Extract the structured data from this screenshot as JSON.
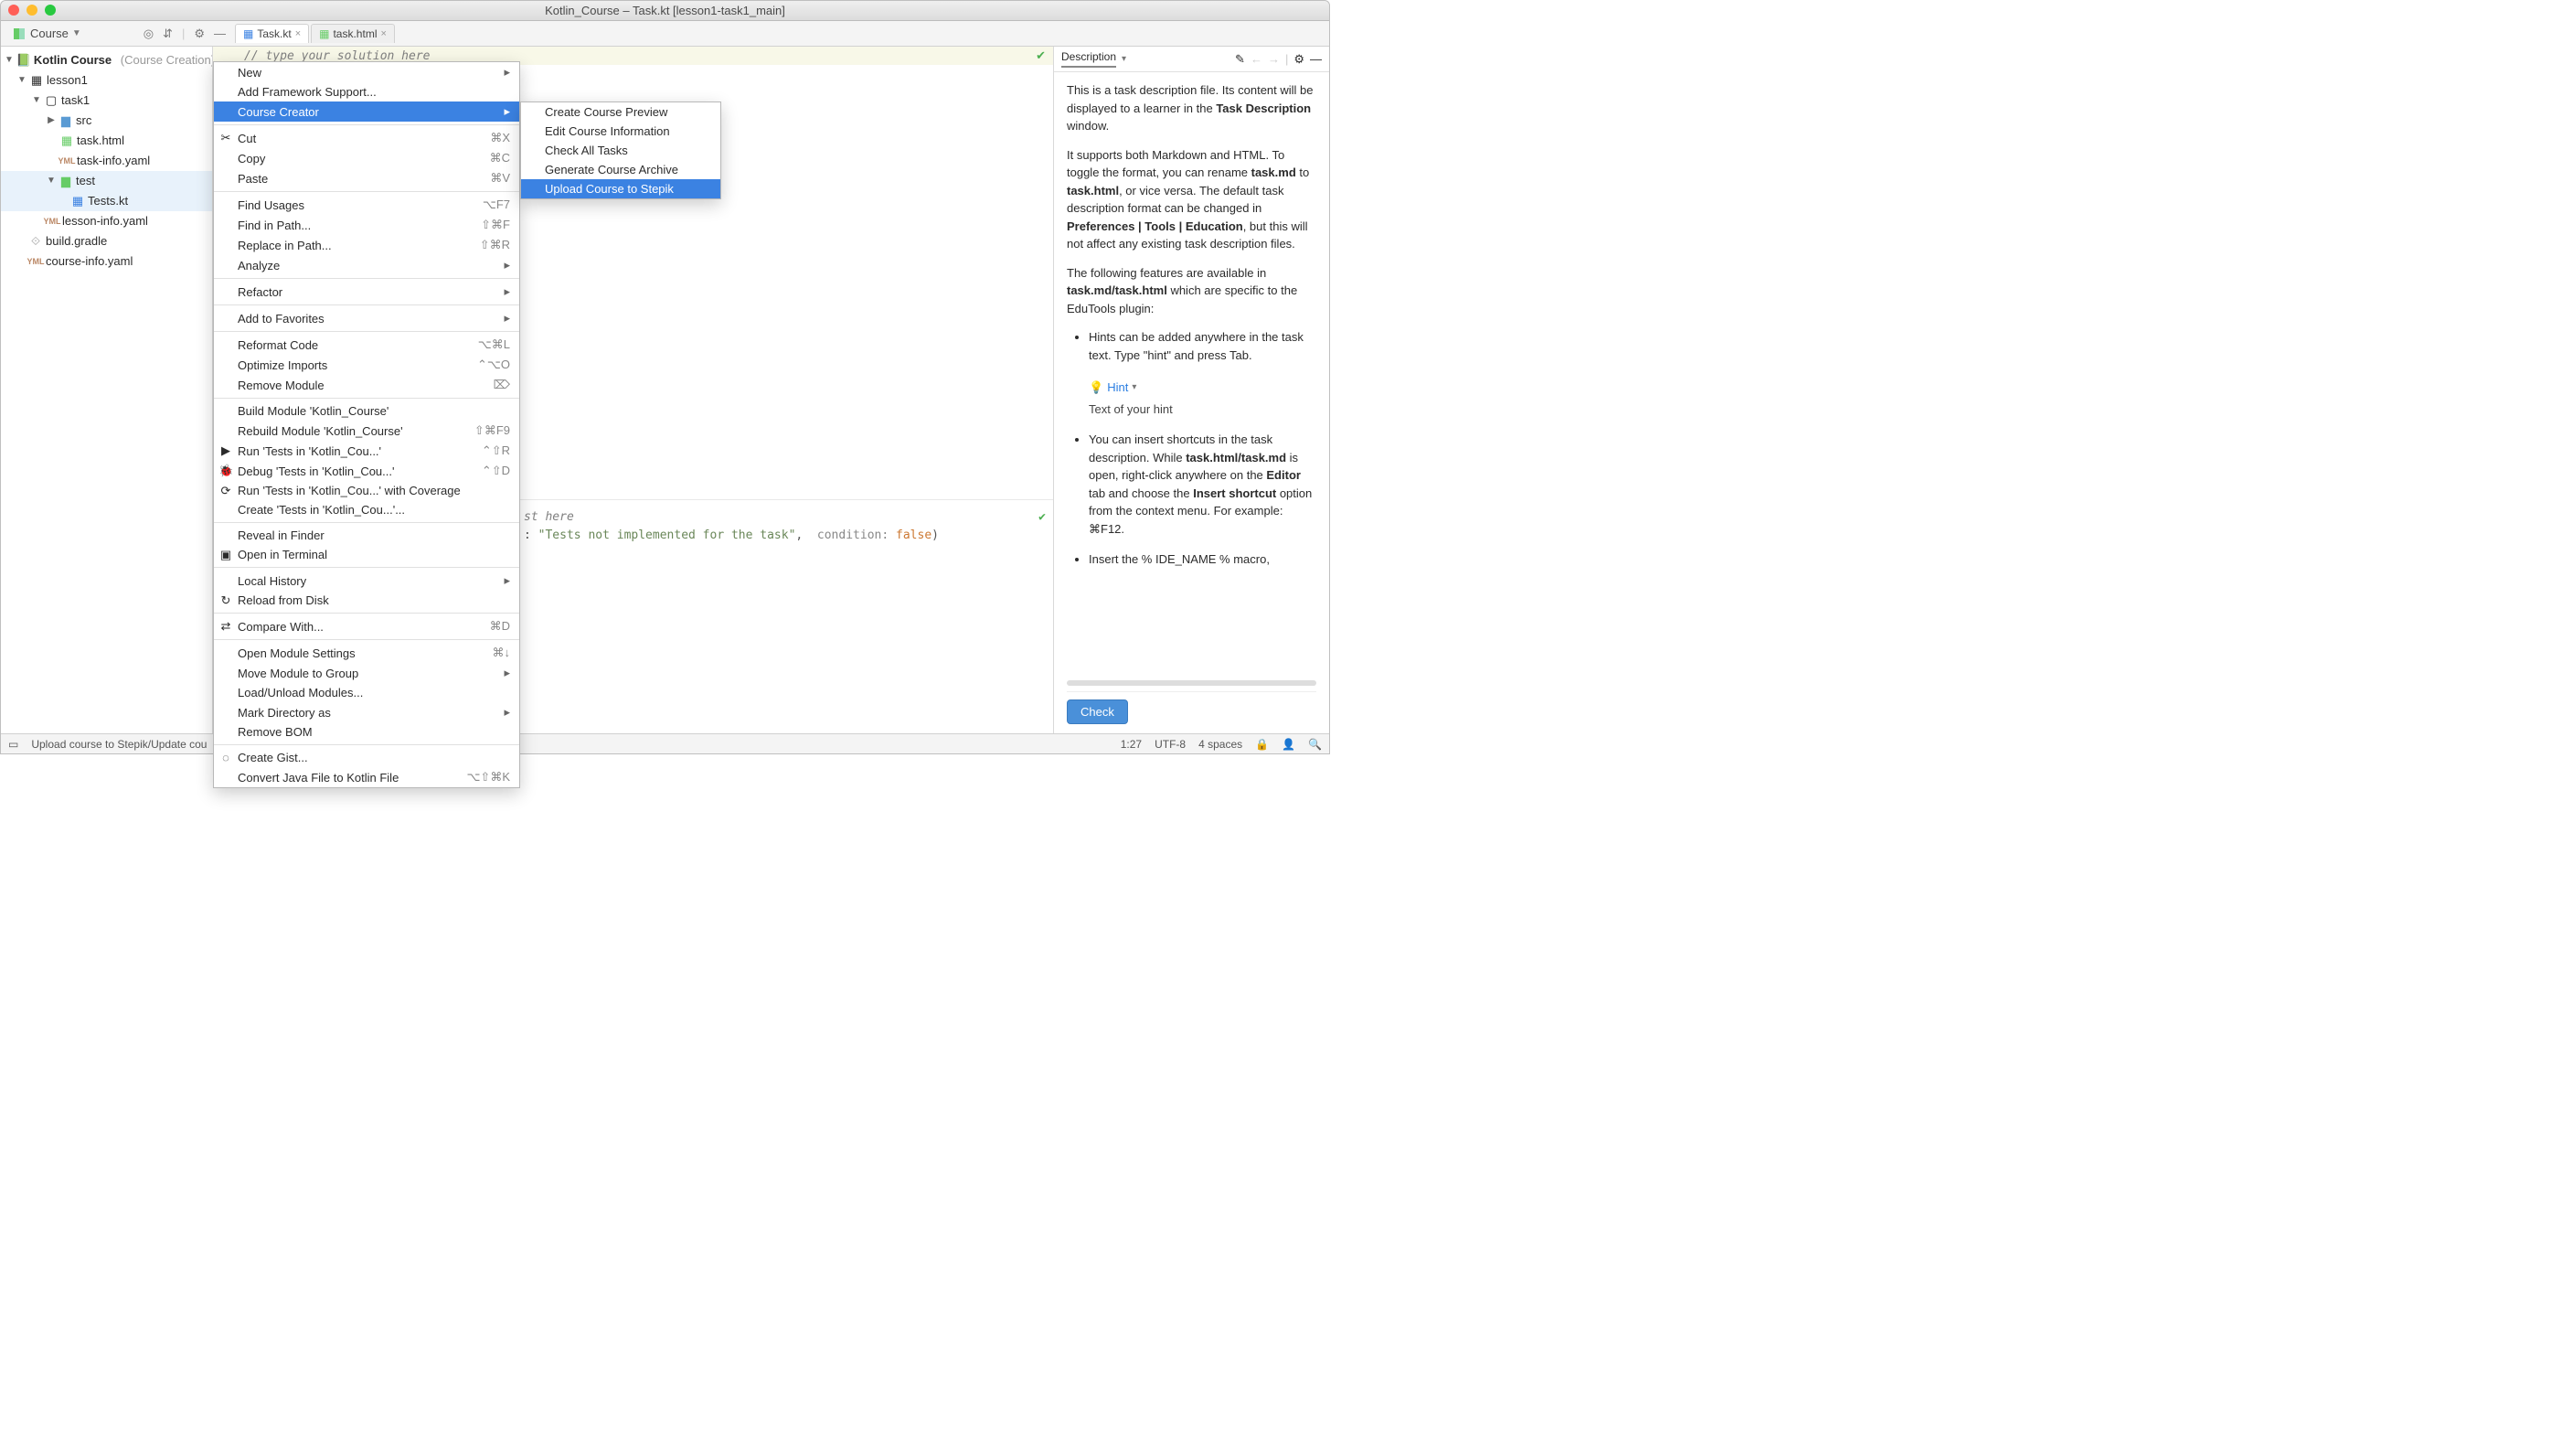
{
  "window": {
    "title": "Kotlin_Course – Task.kt [lesson1-task1_main]"
  },
  "toolbar": {
    "course_label": "Course"
  },
  "tabs": [
    {
      "label": "Task.kt",
      "active": true
    },
    {
      "label": "task.html",
      "active": false
    }
  ],
  "project_tree": {
    "root": "Kotlin Course",
    "root_suffix": "(Course Creation)",
    "items": {
      "lesson1": "lesson1",
      "task1": "task1",
      "src": "src",
      "task_html": "task.html",
      "task_info": "task-info.yaml",
      "test": "test",
      "tests_kt": "Tests.kt",
      "lesson_info": "lesson-info.yaml",
      "build_gradle": "build.gradle",
      "course_info": "course-info.yaml"
    }
  },
  "context_menu": [
    {
      "label": "New",
      "submenu": true
    },
    {
      "label": "Add Framework Support..."
    },
    {
      "label": "Course Creator",
      "submenu": true,
      "highlighted": true
    },
    {
      "sep": true
    },
    {
      "label": "Cut",
      "shortcut": "⌘X",
      "icon": "scissors"
    },
    {
      "label": "Copy",
      "shortcut": "⌘C"
    },
    {
      "label": "Paste",
      "shortcut": "⌘V"
    },
    {
      "sep": true
    },
    {
      "label": "Find Usages",
      "shortcut": "⌥F7"
    },
    {
      "label": "Find in Path...",
      "shortcut": "⇧⌘F"
    },
    {
      "label": "Replace in Path...",
      "shortcut": "⇧⌘R"
    },
    {
      "label": "Analyze",
      "submenu": true
    },
    {
      "sep": true
    },
    {
      "label": "Refactor",
      "submenu": true
    },
    {
      "sep": true
    },
    {
      "label": "Add to Favorites",
      "submenu": true
    },
    {
      "sep": true
    },
    {
      "label": "Reformat Code",
      "shortcut": "⌥⌘L"
    },
    {
      "label": "Optimize Imports",
      "shortcut": "⌃⌥O"
    },
    {
      "label": "Remove Module",
      "shortcut": "⌦"
    },
    {
      "sep": true
    },
    {
      "label": "Build Module 'Kotlin_Course'"
    },
    {
      "label": "Rebuild Module 'Kotlin_Course'",
      "shortcut": "⇧⌘F9"
    },
    {
      "label": "Run 'Tests in 'Kotlin_Cou...'",
      "shortcut": "⌃⇧R",
      "icon": "run"
    },
    {
      "label": "Debug 'Tests in 'Kotlin_Cou...'",
      "shortcut": "⌃⇧D",
      "icon": "debug"
    },
    {
      "label": "Run 'Tests in 'Kotlin_Cou...' with Coverage",
      "icon": "coverage"
    },
    {
      "label": "Create 'Tests in 'Kotlin_Cou...'..."
    },
    {
      "sep": true
    },
    {
      "label": "Reveal in Finder"
    },
    {
      "label": "Open in Terminal",
      "icon": "terminal"
    },
    {
      "sep": true
    },
    {
      "label": "Local History",
      "submenu": true
    },
    {
      "label": "Reload from Disk",
      "icon": "reload"
    },
    {
      "sep": true
    },
    {
      "label": "Compare With...",
      "shortcut": "⌘D",
      "icon": "compare"
    },
    {
      "sep": true
    },
    {
      "label": "Open Module Settings",
      "shortcut": "⌘↓"
    },
    {
      "label": "Move Module to Group",
      "submenu": true
    },
    {
      "label": "Load/Unload Modules..."
    },
    {
      "label": "Mark Directory as",
      "submenu": true
    },
    {
      "label": "Remove BOM"
    },
    {
      "sep": true
    },
    {
      "label": "Create Gist...",
      "icon": "github"
    },
    {
      "label": "Convert Java File to Kotlin File",
      "shortcut": "⌥⇧⌘K"
    }
  ],
  "submenu": [
    {
      "label": "Create Course Preview"
    },
    {
      "label": "Edit Course Information"
    },
    {
      "label": "Check All Tasks"
    },
    {
      "label": "Generate Course Archive"
    },
    {
      "label": "Upload Course to Stepik",
      "highlighted": true
    }
  ],
  "editor": {
    "top_comment": "// type your solution here",
    "bottom_comment": "st here",
    "code_msg_label": ":",
    "code_msg": "\"Tests not implemented for the task\"",
    "code_cond_label": "condition:",
    "code_cond_val": "false",
    "code_paren": ")"
  },
  "description": {
    "title": "Description",
    "p1_a": "This is a task description file. Its content will be displayed to a learner in the ",
    "p1_b": "Task Description",
    "p1_c": " window.",
    "p2_a": "It supports both Markdown and HTML. To toggle the format, you can rename ",
    "p2_b": "task.md",
    "p2_c": " to ",
    "p2_d": "task.html",
    "p2_e": ", or vice versa. The default task description format can be changed in ",
    "p2_f": "Preferences | Tools | Education",
    "p2_g": ", but this will not affect any existing task description files.",
    "p3_a": "The following features are available in ",
    "p3_b": "task.md/task.html",
    "p3_c": " which are specific to the EduTools plugin:",
    "li1": "Hints can be added anywhere in the task text. Type \"hint\" and press Tab.",
    "hint_label": "Hint",
    "hint_text": "Text of your hint",
    "li2_a": "You can insert shortcuts in the task description. While ",
    "li2_b": "task.html/task.md",
    "li2_c": " is open, right-click anywhere on the ",
    "li2_d": "Editor",
    "li2_e": " tab and choose the ",
    "li2_f": "Insert shortcut",
    "li2_g": " option from the context menu. For example: ⌘F12.",
    "li3": "Insert the % IDE_NAME % macro,",
    "check_btn": "Check"
  },
  "statusbar": {
    "left": "Upload course to Stepik/Update cou",
    "pos": "1:27",
    "enc": "UTF-8",
    "indent": "4 spaces"
  }
}
